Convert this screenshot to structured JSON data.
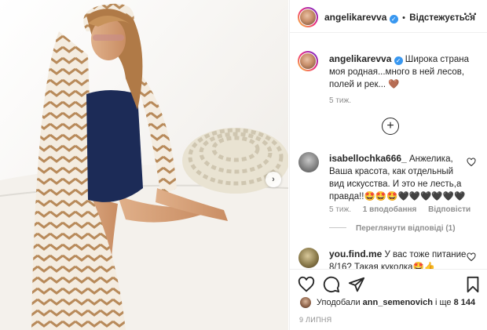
{
  "post": {
    "author": "angelikarevva",
    "follow_status": "Відстежується",
    "more_icon": "more-dots-icon"
  },
  "caption": {
    "author": "angelikarevva",
    "text": "Широка страна моя родная...много в ней лесов, полей и рек... 🤎",
    "time": "5 тиж."
  },
  "comments": [
    {
      "author": "isabellochka666_",
      "text": "Анжелика, Ваша красота, как отдельный вид искусства. И это не лесть,а правда!!🤩🤩🤩🖤🖤🖤🖤🖤🖤",
      "time": "5 тиж.",
      "likes": "1 вподобання",
      "reply": "Відповісти",
      "view_replies": "Переглянути відповіді (1)"
    },
    {
      "author": "you.find.me",
      "text": "У вас тоже питание 8/16? Такая куколка🤩👍"
    }
  ],
  "likes": {
    "prefix": "Уподобали",
    "user": "ann_semenovich",
    "suffix": "і ще",
    "count": "8 144"
  },
  "date": "9 ЛИПНЯ",
  "colors": {
    "verified": "#3897f0",
    "secondary_text": "#8e8e8e",
    "border": "#efefef"
  }
}
